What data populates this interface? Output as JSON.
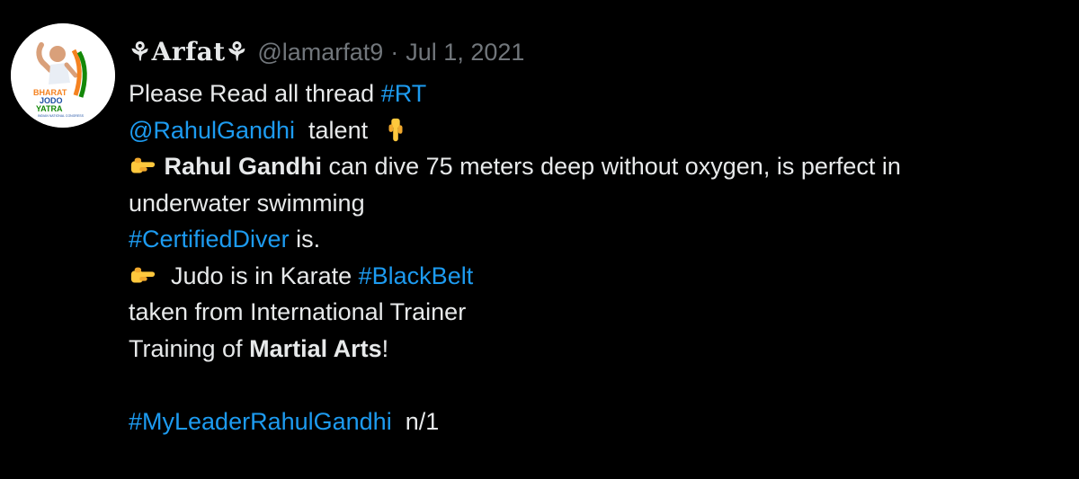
{
  "author": {
    "display_name": "⚘Arfat⚘",
    "handle": "@lamarfat9",
    "separator": "·",
    "date": "Jul 1, 2021",
    "avatar_text": [
      "BHARAT",
      "JODO",
      "YATRA",
      "INDIAN NATIONAL CONGRESS"
    ]
  },
  "tweet": {
    "line1_text": "Please Read all thread ",
    "line1_tag": "#RT",
    "line2_mention": "@RahulGandhi",
    "line2_text": "  talent ",
    "line2_emoji": "pointing-down-hand",
    "line3_emoji": "pointing-right-hand",
    "line3_bold": "Rahul Gandhi",
    "line3_text": " can dive 75 meters deep without oxygen, is perfect in",
    "line4_text": "underwater swimming",
    "line5_tag": "#CertifiedDiver",
    "line5_text": " is.",
    "line6_emoji": "pointing-right-hand",
    "line6_text": " Judo is in Karate ",
    "line6_tag": "#BlackBelt",
    "line7_text": "taken from International Trainer",
    "line8_text": "Training of ",
    "line8_bold": "Martial Arts",
    "line8_end": "!",
    "line10_tag": "#MyLeaderRahulGandhi",
    "line10_text": "  n/1"
  },
  "colors": {
    "background": "#000000",
    "text": "#e7e9ea",
    "muted": "#71767b",
    "link": "#1d9bf0",
    "emoji": "#ffc83d"
  }
}
